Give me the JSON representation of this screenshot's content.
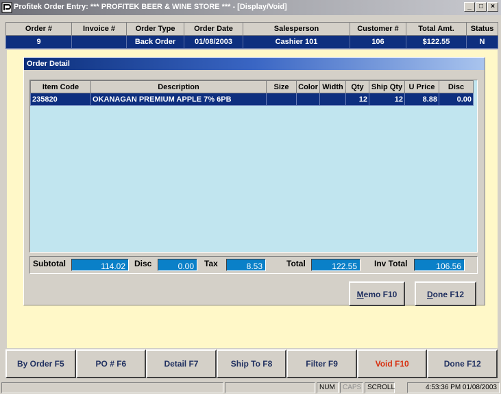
{
  "window": {
    "title": "Profitek Order Entry: *** PROFITEK BEER & WINE STORE *** - [Display/Void]",
    "controls": [
      "_",
      "□",
      "×"
    ]
  },
  "header": {
    "columns": [
      "Order #",
      "Invoice #",
      "Order Type",
      "Order Date",
      "Salesperson",
      "Customer #",
      "Total Amt.",
      "Status"
    ],
    "values": [
      "9",
      "",
      "Back Order",
      "01/08/2003",
      "Cashier 101",
      "106",
      "$122.55",
      "N"
    ]
  },
  "detail": {
    "title": "Order Detail",
    "columns": [
      "Item Code",
      "Description",
      "Size",
      "Color",
      "Width",
      "Qty",
      "Ship Qty",
      "U Price",
      "Disc"
    ],
    "rows": [
      [
        "235820",
        "OKANAGAN PREMIUM APPLE 7% 6PB",
        "",
        "",
        "",
        "12",
        "12",
        "8.88",
        "0.00"
      ]
    ]
  },
  "totals": {
    "subtotal_label": "Subtotal",
    "subtotal": "114.02",
    "disc_label": "Disc",
    "disc": "0.00",
    "tax_label": "Tax",
    "tax": "8.53",
    "total_label": "Total",
    "total": "122.55",
    "inv_total_label": "Inv Total",
    "inv_total": "106.56"
  },
  "panel_buttons": {
    "memo_hotkey": "M",
    "memo_rest": "emo F10",
    "done_hotkey": "D",
    "done_rest": "one F12"
  },
  "bottom_buttons": [
    "By Order F5",
    "PO # F6",
    "Detail F7",
    "Ship To F8",
    "Filter F9",
    "Void F10",
    "Done F12"
  ],
  "colors": {
    "row_navy": "#0e2f7f",
    "grid_bg": "#c1e5ef",
    "total_blue": "#0a80c8",
    "yellow": "#fff8c8",
    "void_red": "#d83010"
  },
  "statusbar": {
    "num": "NUM",
    "caps": "CAPS",
    "scroll": "SCROLL",
    "datetime": "4:53:36 PM 01/08/2003"
  }
}
